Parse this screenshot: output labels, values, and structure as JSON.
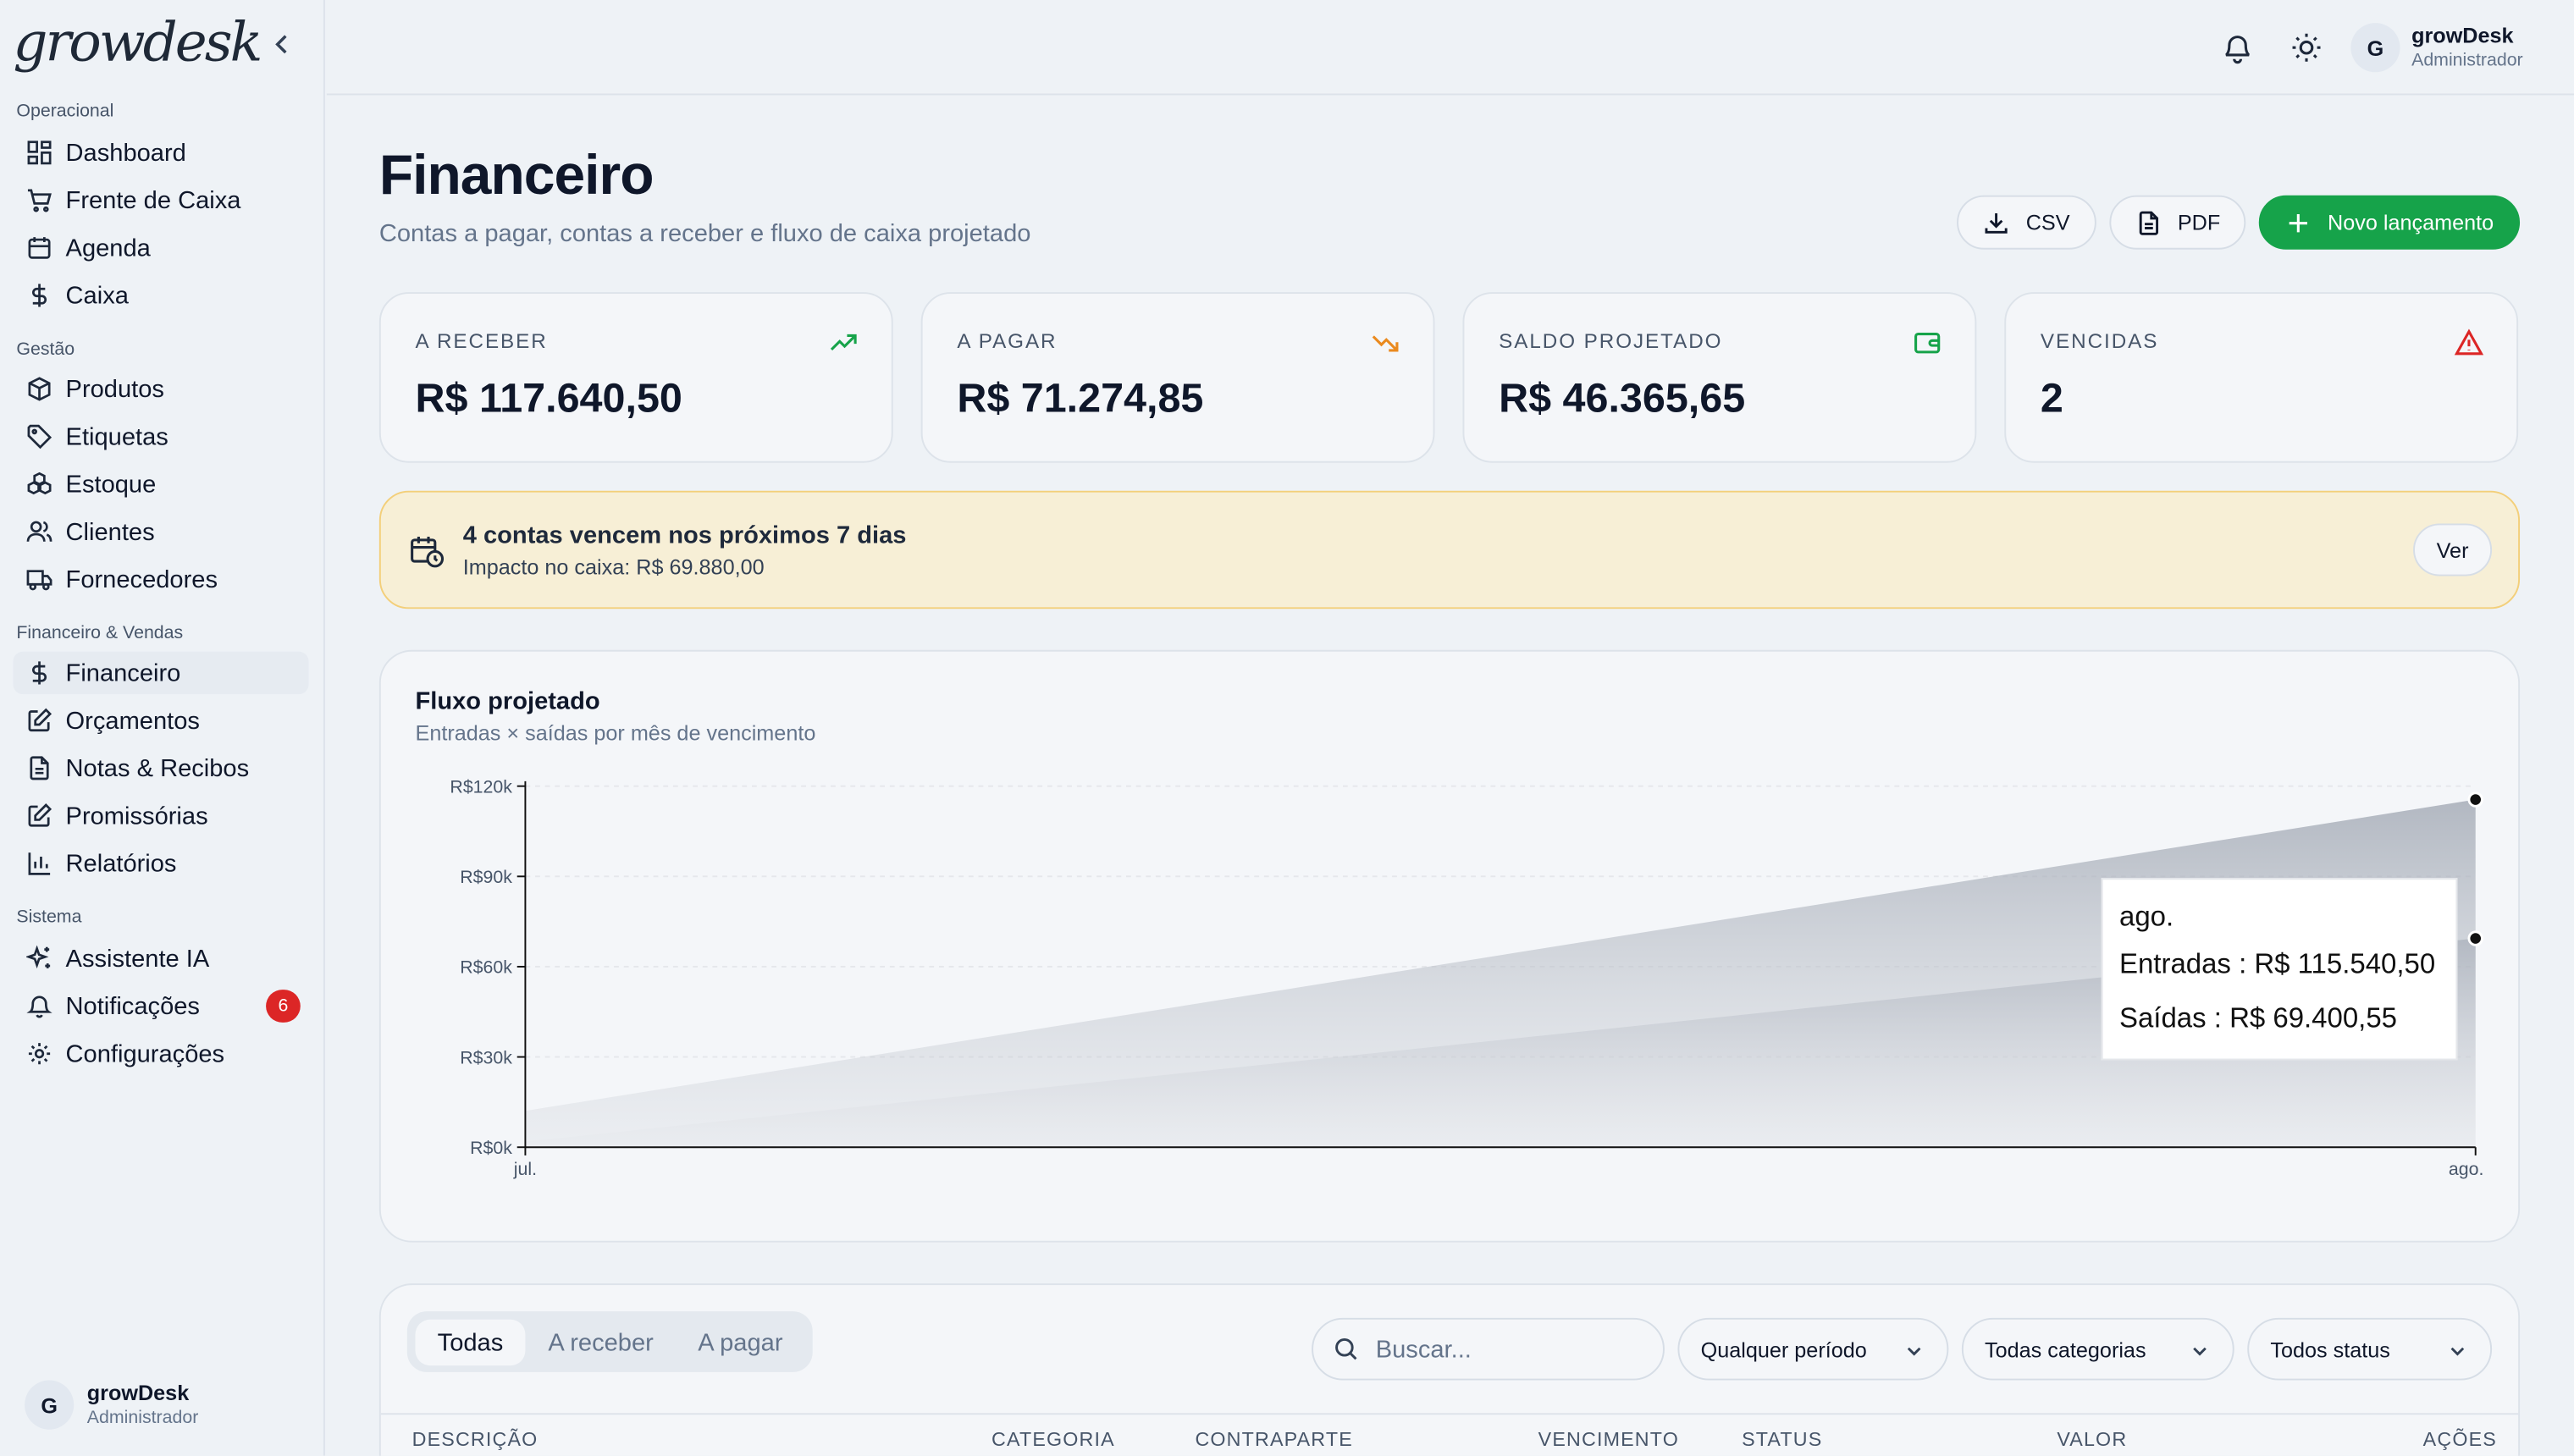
{
  "app": {
    "logo": "growdesk"
  },
  "sidebar": {
    "sections": [
      {
        "title": "Operacional",
        "items": [
          {
            "label": "Dashboard",
            "icon": "dashboard-icon"
          },
          {
            "label": "Frente de Caixa",
            "icon": "cart-icon"
          },
          {
            "label": "Agenda",
            "icon": "calendar-icon"
          },
          {
            "label": "Caixa",
            "icon": "dollar-icon"
          }
        ]
      },
      {
        "title": "Gestão",
        "items": [
          {
            "label": "Produtos",
            "icon": "box-icon"
          },
          {
            "label": "Etiquetas",
            "icon": "tag-icon"
          },
          {
            "label": "Estoque",
            "icon": "boxes-icon"
          },
          {
            "label": "Clientes",
            "icon": "users-icon"
          },
          {
            "label": "Fornecedores",
            "icon": "truck-icon"
          }
        ]
      },
      {
        "title": "Financeiro & Vendas",
        "items": [
          {
            "label": "Financeiro",
            "icon": "dollar-icon",
            "active": true
          },
          {
            "label": "Orçamentos",
            "icon": "edit-icon"
          },
          {
            "label": "Notas & Recibos",
            "icon": "file-icon"
          },
          {
            "label": "Promissórias",
            "icon": "edit-icon"
          },
          {
            "label": "Relatórios",
            "icon": "bar-chart-icon"
          }
        ]
      },
      {
        "title": "Sistema",
        "items": [
          {
            "label": "Assistente IA",
            "icon": "sparkles-icon"
          },
          {
            "label": "Notificações",
            "icon": "bell-icon",
            "badge": "6"
          },
          {
            "label": "Configurações",
            "icon": "gear-icon"
          }
        ]
      }
    ],
    "user": {
      "initial": "G",
      "name": "growDesk",
      "role": "Administrador"
    }
  },
  "topbar": {
    "user": {
      "initial": "G",
      "name": "growDesk",
      "role": "Administrador"
    }
  },
  "page": {
    "title": "Financeiro",
    "subtitle": "Contas a pagar, contas a receber e fluxo de caixa projetado",
    "actions": {
      "csv": "CSV",
      "pdf": "PDF",
      "new": "Novo lançamento"
    }
  },
  "kpis": [
    {
      "label": "A RECEBER",
      "value": "R$ 117.640,50",
      "icon": "trending-up-icon",
      "color": "#16a34a"
    },
    {
      "label": "A PAGAR",
      "value": "R$ 71.274,85",
      "icon": "trending-down-icon",
      "color": "#ea8a1f"
    },
    {
      "label": "SALDO PROJETADO",
      "value": "R$ 46.365,65",
      "icon": "wallet-icon",
      "color": "#16a34a"
    },
    {
      "label": "VENCIDAS",
      "value": "2",
      "icon": "warning-icon",
      "color": "#dc2626"
    }
  ],
  "alert": {
    "title": "4 contas vencem nos próximos 7 dias",
    "detail": "Impacto no caixa: R$ 69.880,00",
    "button": "Ver"
  },
  "chart_panel": {
    "title": "Fluxo projetado",
    "subtitle": "Entradas × saídas por mês de vencimento"
  },
  "chart_data": {
    "type": "area",
    "title": "Fluxo projetado",
    "subtitle": "Entradas × saídas por mês de vencimento",
    "categories": [
      "jul.",
      "ago."
    ],
    "series": [
      {
        "name": "Entradas",
        "values": [
          12100,
          115540.5
        ]
      },
      {
        "name": "Saídas",
        "values": [
          1874.3,
          69400.55
        ]
      }
    ],
    "ylim": [
      0,
      120000
    ],
    "yticks": [
      "R$0k",
      "R$30k",
      "R$60k",
      "R$90k",
      "R$120k"
    ],
    "grid": true,
    "tooltip": {
      "category": "ago.",
      "lines": [
        "Entradas : R$ 115.540,50",
        "Saídas : R$ 69.400,55"
      ]
    }
  },
  "filters": {
    "tabs": [
      "Todas",
      "A receber",
      "A pagar"
    ],
    "search_placeholder": "Buscar...",
    "period": "Qualquer período",
    "category": "Todas categorias",
    "status": "Todos status"
  },
  "table": {
    "headers": [
      "DESCRIÇÃO",
      "CATEGORIA",
      "CONTRAPARTE",
      "VENCIMENTO",
      "STATUS",
      "VALOR",
      "AÇÕES"
    ]
  }
}
